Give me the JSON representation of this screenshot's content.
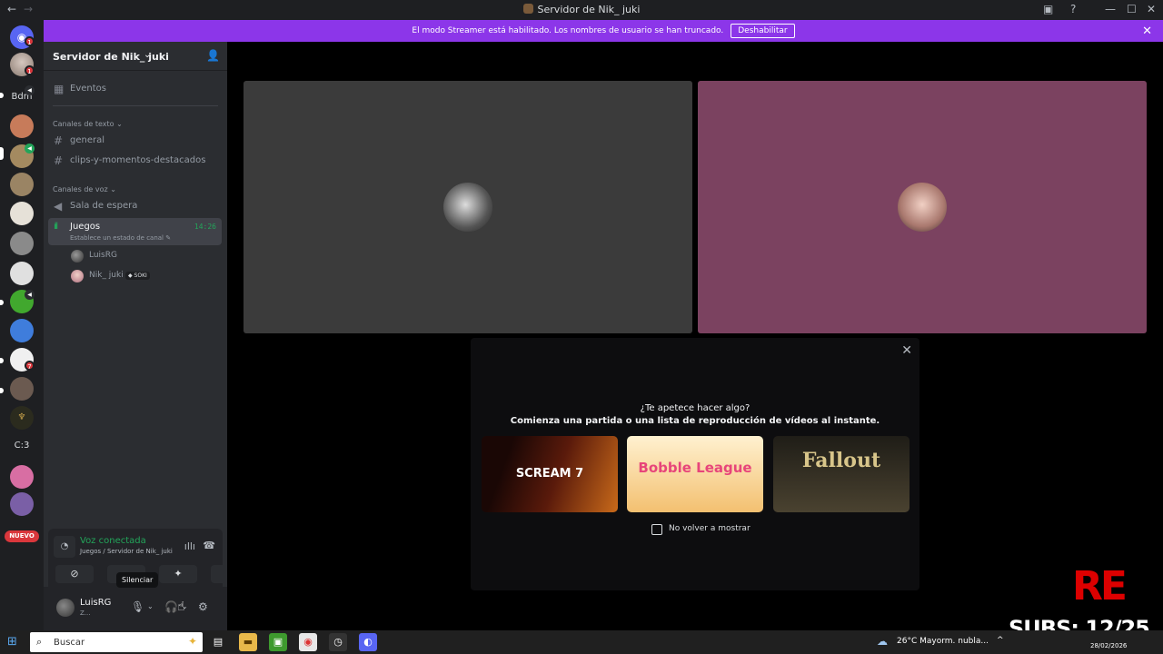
{
  "titlebar": {
    "back": "←",
    "forward": "→",
    "title": "Servidor de Nik_ juki",
    "inbox_icon": "inbox-icon",
    "help_icon": "help-icon",
    "minimize": "—",
    "maximize": "☐",
    "close": "✕"
  },
  "banner": {
    "text": "El modo Streamer está habilitado. Los nombres de usuario se han truncado.",
    "button": "Deshabilitar",
    "close": "✕"
  },
  "rail": {
    "servers": [
      {
        "name": "home",
        "color": "#5865f2",
        "badge": "1"
      },
      {
        "name": "dm-avatar",
        "color": "#b8a9a0",
        "badge": "1"
      },
      {
        "name": "Bdm",
        "text": "Bdm"
      },
      {
        "name": "anime-server",
        "color": "#c77b5a"
      },
      {
        "name": "cat-server",
        "color": "#a48a60"
      },
      {
        "name": "picture-server",
        "color": "#9a8464"
      },
      {
        "name": "white-cat-server",
        "color": "#e6e1d8"
      },
      {
        "name": "gray-cat-server",
        "color": "#8a8a8a"
      },
      {
        "name": "bird-server",
        "color": "#e0e0e0"
      },
      {
        "name": "minecraft-server",
        "color": "#41a82e"
      },
      {
        "name": "game-server",
        "color": "#3f7ddc"
      },
      {
        "name": "meme-server",
        "color": "#f0f0f0",
        "badge": "7"
      },
      {
        "name": "art-server",
        "color": "#6b5a50"
      },
      {
        "name": "crest-server",
        "color": "#2b2b1e"
      },
      {
        "name": "C:3",
        "text": "C:3"
      },
      {
        "name": "shizzz-server",
        "color": "#d86ea3"
      },
      {
        "name": "girl-server",
        "color": "#7a5fa6"
      }
    ],
    "nuevo": "NUEVO"
  },
  "sidebar": {
    "server_name": "Servidor de Nik_ juki",
    "events": "Eventos",
    "text_category": "Canales de texto",
    "text_channels": [
      "general",
      "clips-y-momentos-destacados"
    ],
    "voice_category": "Canales de voz",
    "waiting_room": "Sala de espera",
    "active_channel": {
      "name": "Juegos",
      "time": "14:26",
      "status": "Establece un estado de canal"
    },
    "voice_users": [
      {
        "name": "LuisRG",
        "color": "#555555"
      },
      {
        "name": "Nik_ juki",
        "color": "#c98aa0",
        "tag": "SOKI"
      }
    ]
  },
  "voice_panel": {
    "title": "Voz conectada",
    "subtitle": "Juegos / Servidor de Nik_ juki"
  },
  "user_bar": {
    "name": "LuisRG",
    "status": "Z...",
    "tooltip": "Silenciar"
  },
  "stage": {
    "tiles": [
      {
        "name": "tile-luisrg",
        "bg": "#3b3b3b",
        "avatar": "#9a9a9a"
      },
      {
        "name": "tile-nikjuki",
        "bg": "#7b4260",
        "avatar": "#e2b3a6"
      }
    ],
    "activity": {
      "title": "¿Te apetece hacer algo?",
      "subtitle": "Comienza una partida o una lista de reproducción de vídeos al instante.",
      "games": [
        {
          "name": "Scream 7",
          "label": "SCREAM 7",
          "bg": "#3a120a",
          "fg": "#ffffff"
        },
        {
          "name": "Bobble League",
          "label": "Bobble League",
          "bg": "#f5c46a",
          "fg": "#e7457a"
        },
        {
          "name": "Fallout",
          "label": "Fallout",
          "bg": "#2f2a22",
          "fg": "#d8c58a"
        }
      ],
      "checkbox_label": "No volver a mostrar"
    },
    "watermark": "RE",
    "subs": "SUBS: 12/25"
  },
  "taskbar": {
    "search_placeholder": "Buscar",
    "weather": "26°C  Mayorm. nubla...",
    "tray": "^",
    "date": "28/02/2026"
  }
}
